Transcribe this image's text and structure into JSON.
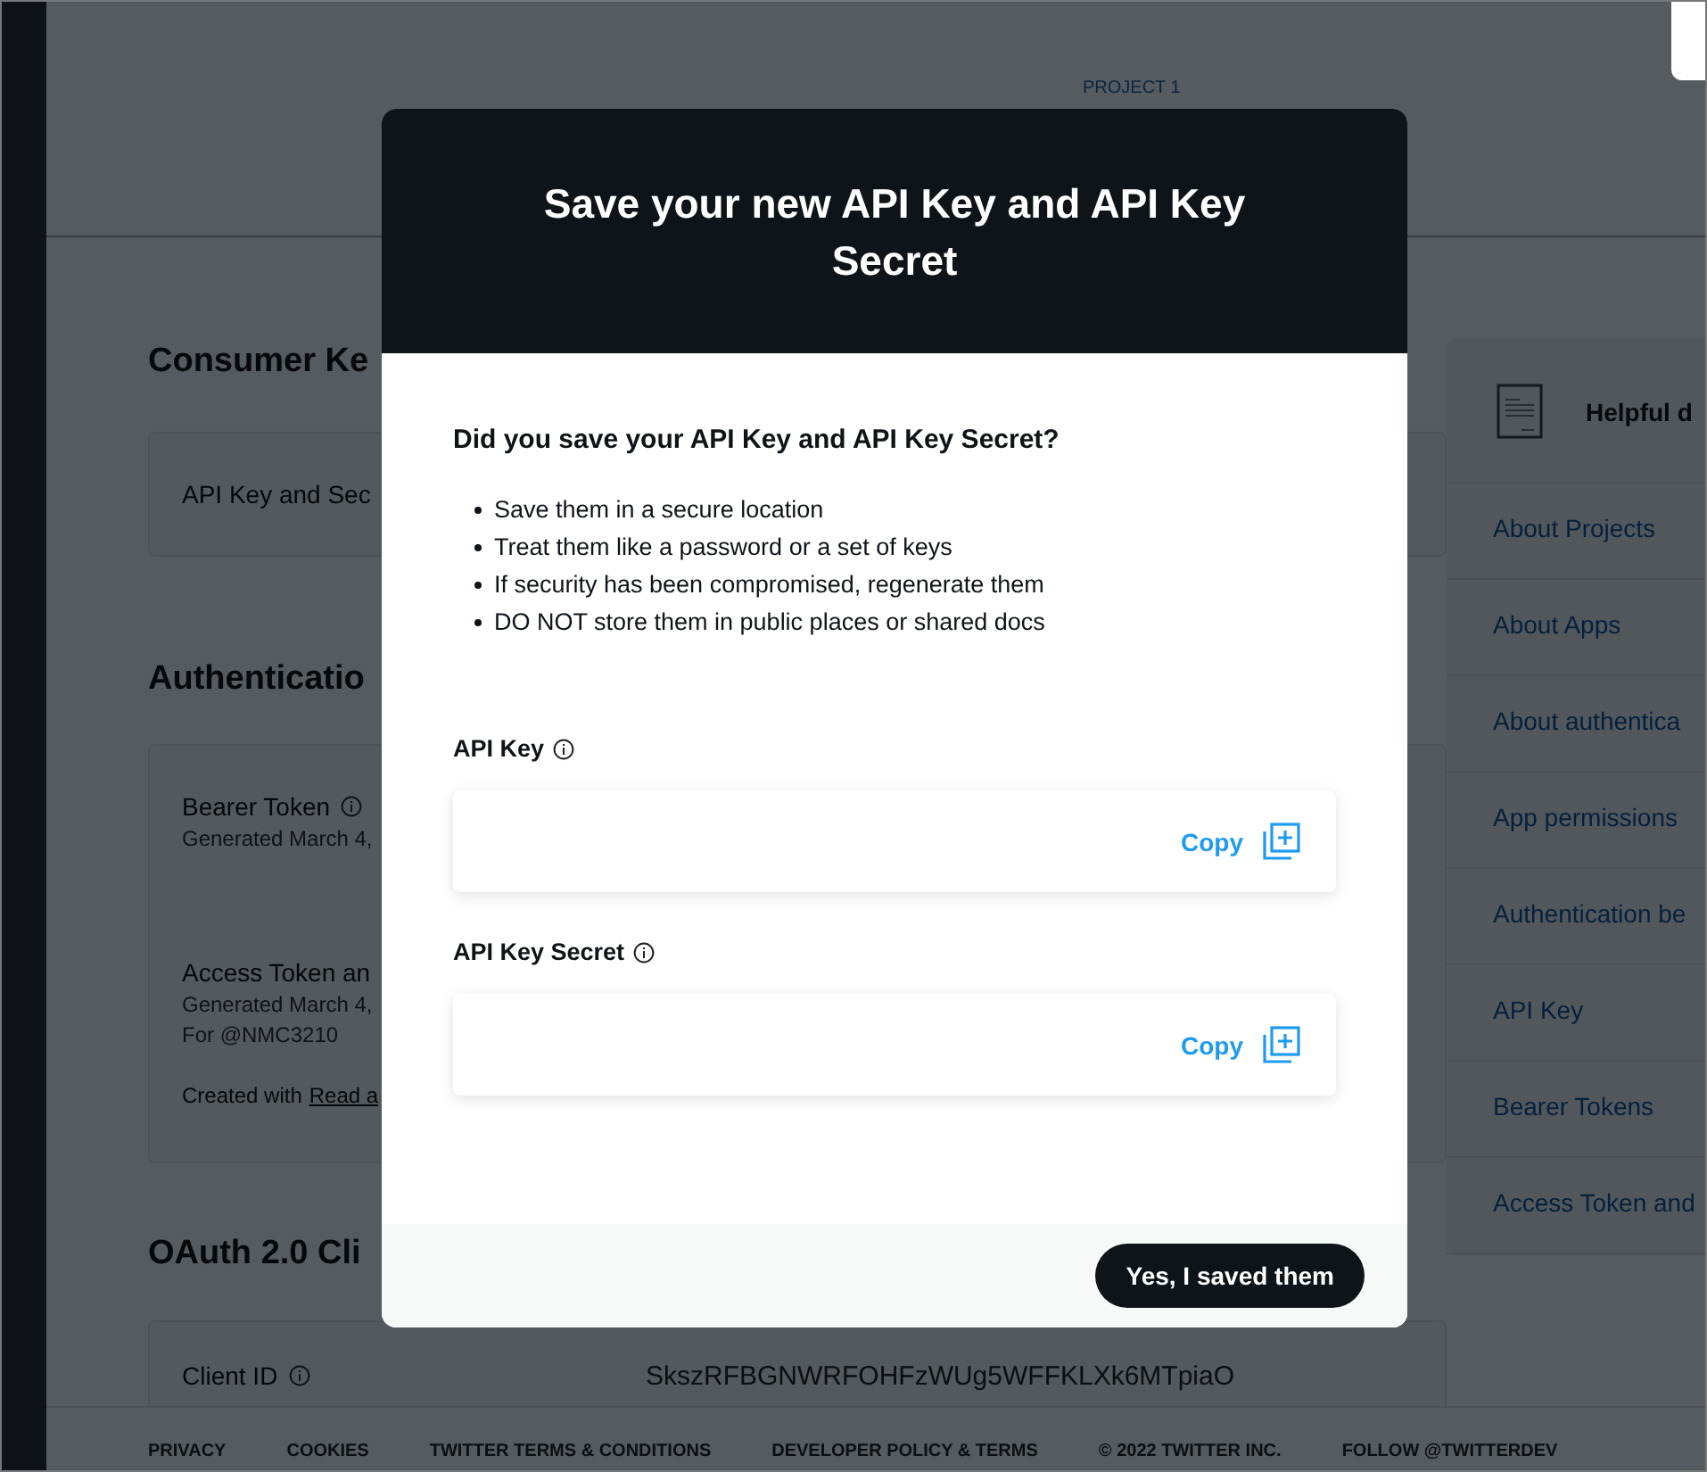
{
  "project_label": "PROJECT 1",
  "background": {
    "consumer_heading": "Consumer Ke",
    "consumer_row": "API Key and Sec",
    "auth_heading": "Authenticatio",
    "bearer": {
      "label": "Bearer Token",
      "generated": "Generated March 4,"
    },
    "access": {
      "label": "Access Token an",
      "generated": "Generated March 4,",
      "for": "For @NMC3210",
      "created": "Created with",
      "created_link": "Read a"
    },
    "oauth_heading": "OAuth 2.0 Cli",
    "client_id": {
      "label": "Client ID",
      "value": "SkszRFBGNWRFOHFzWUg5WFFKLXk6MTpiaO"
    }
  },
  "docs": {
    "title": "Helpful d",
    "links": [
      "About Projects",
      "About Apps",
      "About authentica",
      "App permissions",
      "Authentication be",
      "API Key",
      "Bearer Tokens",
      "Access Token and"
    ]
  },
  "footer": {
    "links": [
      "PRIVACY",
      "COOKIES",
      "TWITTER TERMS & CONDITIONS",
      "DEVELOPER POLICY & TERMS"
    ],
    "copyright": "© 2022 TWITTER INC.",
    "follow": "FOLLOW **@TWITTERDEV**"
  },
  "modal": {
    "title": "Save your new API Key and API Key Secret",
    "question": "Did you save your API Key and API Key Secret?",
    "tips": [
      "Save them in a secure location",
      "Treat them like a password or a set of keys",
      "If security has been compromised, regenerate them",
      "DO NOT store them in public places or shared docs"
    ],
    "fields": [
      {
        "label": "API Key",
        "copy": "Copy"
      },
      {
        "label": "API Key Secret",
        "copy": "Copy"
      }
    ],
    "confirm": "Yes, I saved them"
  }
}
